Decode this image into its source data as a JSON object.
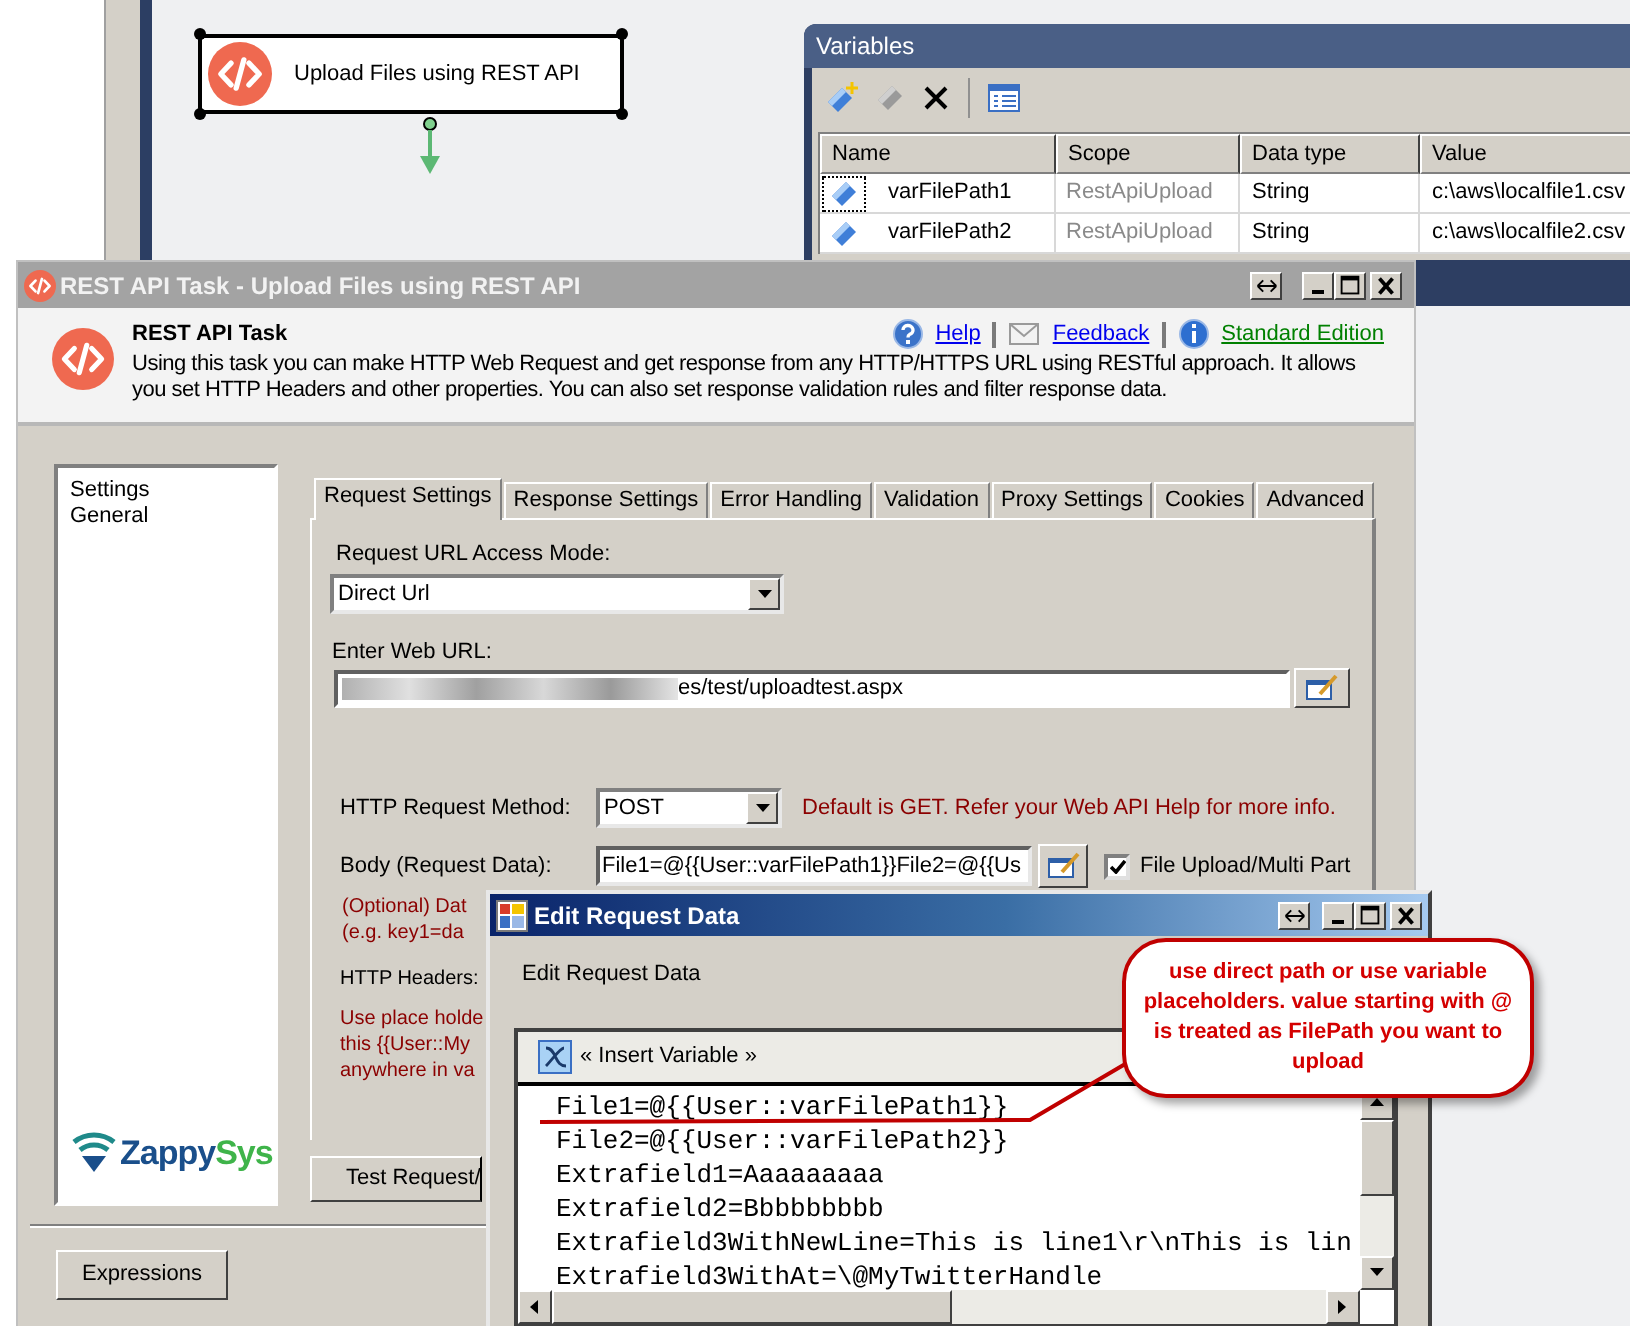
{
  "designer": {
    "task": {
      "label": "Upload Files using REST API"
    }
  },
  "variables_window": {
    "title": "Variables",
    "columns": [
      "Name",
      "Scope",
      "Data type",
      "Value"
    ],
    "rows": [
      {
        "name": "varFilePath1",
        "scope": "RestApiUpload",
        "data_type": "String",
        "value": "c:\\aws\\localfile1.csv",
        "selected": true
      },
      {
        "name": "varFilePath2",
        "scope": "RestApiUpload",
        "data_type": "String",
        "value": "c:\\aws\\localfile2.csv",
        "selected": false
      }
    ]
  },
  "main_dialog": {
    "title": "REST API Task - Upload Files using REST API",
    "header": {
      "title": "REST API Task",
      "description": "Using this task you can make HTTP Web Request and get response from any HTTP/HTTPS URL using RESTful approach. It allows you set HTTP Headers and other properties. You can also set response validation rules and filter response data.",
      "links": [
        {
          "label": "Help",
          "kind": "help"
        },
        {
          "label": "Feedback",
          "kind": "feedback"
        },
        {
          "label": "Standard Edition",
          "kind": "edition"
        }
      ]
    },
    "nav_items": [
      "Settings",
      "General"
    ],
    "logo_text": [
      "Zappy",
      "Sys"
    ],
    "tabs": [
      {
        "label": "Request Settings",
        "selected": true
      },
      {
        "label": "Response Settings",
        "selected": false
      },
      {
        "label": "Error Handling",
        "selected": false
      },
      {
        "label": "Validation",
        "selected": false
      },
      {
        "label": "Proxy Settings",
        "selected": false
      },
      {
        "label": "Cookies",
        "selected": false
      },
      {
        "label": "Advanced",
        "selected": false
      }
    ],
    "url_mode": {
      "label": "Request URL Access Mode:",
      "value": "Direct Url"
    },
    "url": {
      "label": "Enter Web URL:",
      "value": "es/test/uploadtest.aspx"
    },
    "method": {
      "label": "HTTP Request Method:",
      "value": "POST",
      "hint": "Default is GET. Refer your Web API Help for more info."
    },
    "body": {
      "label": "Body (Request Data):",
      "value": "File1=@{{User::varFilePath1}}File2=@{{Us",
      "multipart": {
        "label": "File Upload/Multi Part",
        "checked": true
      },
      "hint_lines": [
        "(Optional) Dat",
        "(e.g. key1=da"
      ]
    },
    "headers": {
      "label": "HTTP Headers:",
      "hint_lines": [
        "Use place holde",
        "this {{User::My",
        "anywhere in va"
      ]
    },
    "test_button": "Test Request/",
    "expressions_button": "Expressions"
  },
  "edit_dialog": {
    "title": "Edit Request Data",
    "label": "Edit Request Data",
    "insert_variable": "« Insert Variable »",
    "lines": [
      "File1=@{{User::varFilePath1}}",
      "File2=@{{User::varFilePath2}}",
      "Extrafield1=Aaaaaaaaa",
      "Extrafield2=Bbbbbbbbb",
      "Extrafield3WithNewLine=This is line1\\r\\nThis is lin",
      "Extrafield3WithAt=\\@MyTwitterHandle"
    ]
  },
  "callout": {
    "text": "use direct path or use variable placeholders. value starting with @ is treated as FilePath you want to upload"
  }
}
